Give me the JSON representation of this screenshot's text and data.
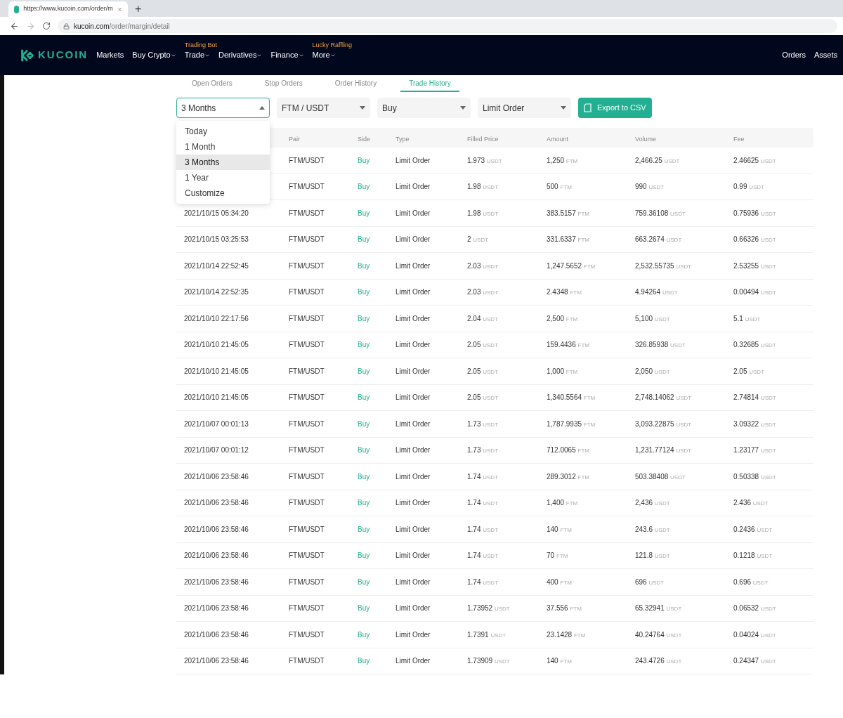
{
  "browser": {
    "tab_title": "https://www.kucoin.com/order/m",
    "new_tab": "+",
    "address_host": "kucoin.com",
    "address_path": "/order/margin/detail"
  },
  "nav": {
    "logo": "KUCOIN",
    "items": [
      {
        "label": "Markets",
        "caret": false
      },
      {
        "label": "Buy Crypto",
        "caret": true
      },
      {
        "label": "Trade",
        "caret": true,
        "promo": "Trading Bot"
      },
      {
        "label": "Derivatives",
        "caret": true
      },
      {
        "label": "Finance",
        "caret": true
      },
      {
        "label": "More",
        "caret": true,
        "promo": "Lucky Raffling"
      }
    ],
    "right": [
      "Orders",
      "Assets"
    ]
  },
  "tabs": [
    {
      "label": "Open Orders",
      "selected": false
    },
    {
      "label": "Stop Orders",
      "selected": false
    },
    {
      "label": "Order History",
      "selected": false
    },
    {
      "label": "Trade History",
      "selected": true
    }
  ],
  "filters": [
    {
      "value": "3 Months",
      "expanded": true
    },
    {
      "value": "FTM / USDT",
      "expanded": false
    },
    {
      "value": "Buy",
      "expanded": false
    },
    {
      "value": "Limit Order",
      "expanded": false
    }
  ],
  "export_button": "Export to CSV",
  "dropdown": [
    {
      "label": "Today",
      "selected": false
    },
    {
      "label": "1 Month",
      "selected": false
    },
    {
      "label": "3 Months",
      "selected": true
    },
    {
      "label": "1 Year",
      "selected": false
    },
    {
      "label": "Customize",
      "selected": false
    }
  ],
  "table": {
    "columns": [
      "",
      "Pair",
      "Side",
      "Type",
      "Filled Price",
      "Amount",
      "Volume",
      "Fee"
    ],
    "rows": [
      {
        "cells": [
          "",
          "FTM/USDT",
          "Buy",
          "Limit Order",
          "1.973 USDT",
          "1,250 FTM",
          "2,466.25 USDT",
          "2.46625 USDT"
        ]
      },
      {
        "cells": [
          "",
          "FTM/USDT",
          "Buy",
          "Limit Order",
          "1.98 USDT",
          "500 FTM",
          "990 USDT",
          "0.99 USDT"
        ]
      },
      {
        "cells": [
          "2021/10/15 05:34:20",
          "FTM/USDT",
          "Buy",
          "Limit Order",
          "1.98 USDT",
          "383.5157 FTM",
          "759.36108 USDT",
          "0.75936 USDT"
        ]
      },
      {
        "cells": [
          "2021/10/15 03:25:53",
          "FTM/USDT",
          "Buy",
          "Limit Order",
          "2 USDT",
          "331.6337 FTM",
          "663.2674 USDT",
          "0.66326 USDT"
        ]
      },
      {
        "cells": [
          "2021/10/14 22:52:45",
          "FTM/USDT",
          "Buy",
          "Limit Order",
          "2.03 USDT",
          "1,247.5652 FTM",
          "2,532.55735 USDT",
          "2.53255 USDT"
        ]
      },
      {
        "cells": [
          "2021/10/14 22:52:35",
          "FTM/USDT",
          "Buy",
          "Limit Order",
          "2.03 USDT",
          "2.4348 FTM",
          "4.94264 USDT",
          "0.00494 USDT"
        ]
      },
      {
        "cells": [
          "2021/10/10 22:17:56",
          "FTM/USDT",
          "Buy",
          "Limit Order",
          "2.04 USDT",
          "2,500 FTM",
          "5,100 USDT",
          "5.1 USDT"
        ]
      },
      {
        "cells": [
          "2021/10/10 21:45:05",
          "FTM/USDT",
          "Buy",
          "Limit Order",
          "2.05 USDT",
          "159.4436 FTM",
          "326.85938 USDT",
          "0.32685 USDT"
        ]
      },
      {
        "cells": [
          "2021/10/10 21:45:05",
          "FTM/USDT",
          "Buy",
          "Limit Order",
          "2.05 USDT",
          "1,000 FTM",
          "2,050 USDT",
          "2.05 USDT"
        ]
      },
      {
        "cells": [
          "2021/10/10 21:45:05",
          "FTM/USDT",
          "Buy",
          "Limit Order",
          "2.05 USDT",
          "1,340.5564 FTM",
          "2,748.14062 USDT",
          "2.74814 USDT"
        ]
      },
      {
        "cells": [
          "2021/10/07 00:01:13",
          "FTM/USDT",
          "Buy",
          "Limit Order",
          "1.73 USDT",
          "1,787.9935 FTM",
          "3,093.22875 USDT",
          "3.09322 USDT"
        ]
      },
      {
        "cells": [
          "2021/10/07 00:01:12",
          "FTM/USDT",
          "Buy",
          "Limit Order",
          "1.73 USDT",
          "712.0065 FTM",
          "1,231.77124 USDT",
          "1.23177 USDT"
        ]
      },
      {
        "cells": [
          "2021/10/06 23:58:46",
          "FTM/USDT",
          "Buy",
          "Limit Order",
          "1.74 USDT",
          "289.3012 FTM",
          "503.38408 USDT",
          "0.50338 USDT"
        ]
      },
      {
        "cells": [
          "2021/10/06 23:58:46",
          "FTM/USDT",
          "Buy",
          "Limit Order",
          "1.74 USDT",
          "1,400 FTM",
          "2,436 USDT",
          "2.436 USDT"
        ]
      },
      {
        "cells": [
          "2021/10/06 23:58:46",
          "FTM/USDT",
          "Buy",
          "Limit Order",
          "1.74 USDT",
          "140 FTM",
          "243.6 USDT",
          "0.2436 USDT"
        ]
      },
      {
        "cells": [
          "2021/10/06 23:58:46",
          "FTM/USDT",
          "Buy",
          "Limit Order",
          "1.74 USDT",
          "70 FTM",
          "121.8 USDT",
          "0.1218 USDT"
        ]
      },
      {
        "cells": [
          "2021/10/06 23:58:46",
          "FTM/USDT",
          "Buy",
          "Limit Order",
          "1.74 USDT",
          "400 FTM",
          "696 USDT",
          "0.696 USDT"
        ]
      },
      {
        "cells": [
          "2021/10/06 23:58:46",
          "FTM/USDT",
          "Buy",
          "Limit Order",
          "1.73952 USDT",
          "37.556 FTM",
          "65.32941 USDT",
          "0.06532 USDT"
        ]
      },
      {
        "cells": [
          "2021/10/06 23:58:46",
          "FTM/USDT",
          "Buy",
          "Limit Order",
          "1.7391 USDT",
          "23.1428 FTM",
          "40.24764 USDT",
          "0.04024 USDT"
        ]
      },
      {
        "cells": [
          "2021/10/06 23:58:46",
          "FTM/USDT",
          "Buy",
          "Limit Order",
          "1.73909 USDT",
          "140 FTM",
          "243.4726 USDT",
          "0.24347 USDT"
        ]
      }
    ]
  }
}
